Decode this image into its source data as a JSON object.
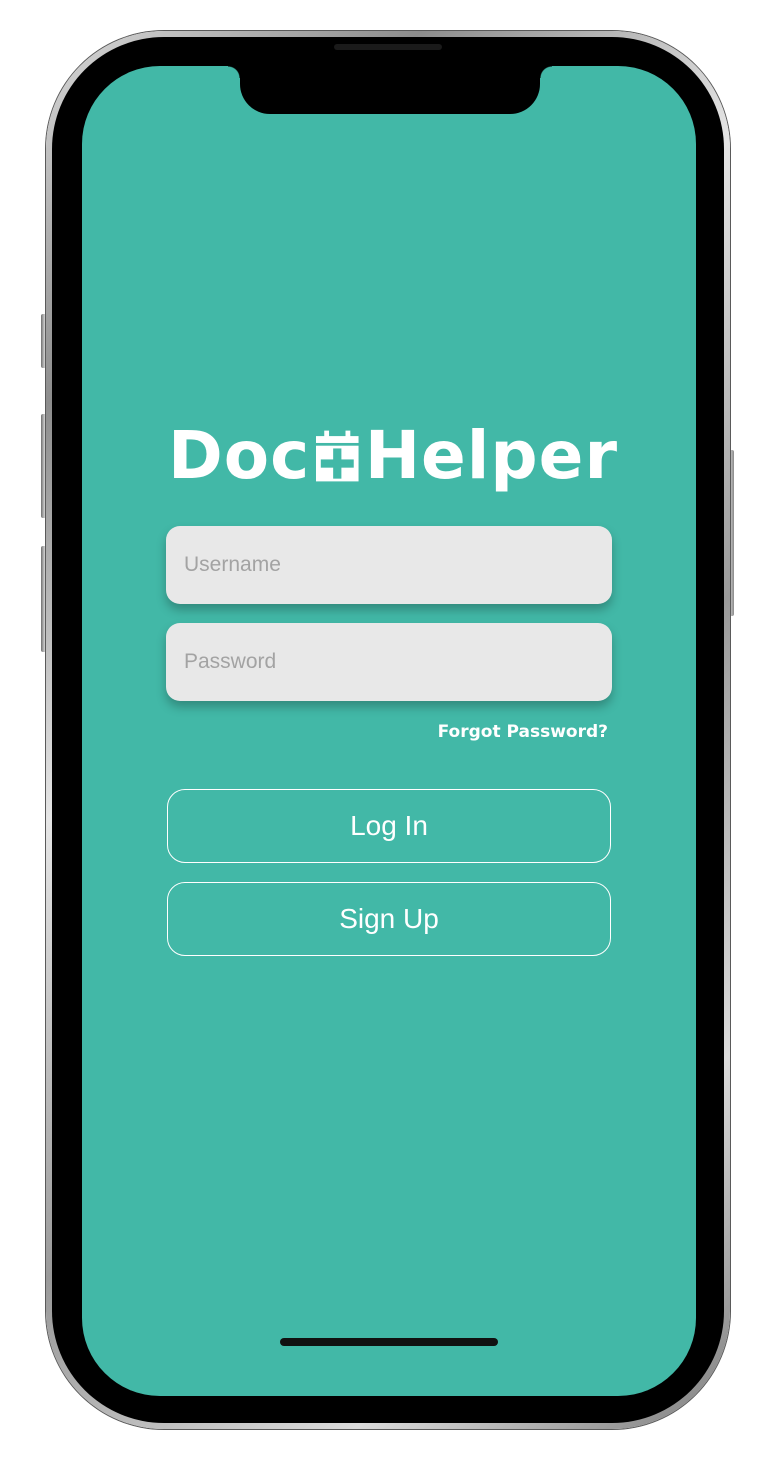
{
  "app": {
    "brand": {
      "name_part1": "Doc",
      "name_part2": "Helper",
      "icon": "calendar-plus-icon"
    },
    "login_form": {
      "username_placeholder": "Username",
      "password_placeholder": "Password",
      "forgot_password_label": "Forgot Password?",
      "login_label": "Log In",
      "signup_label": "Sign Up"
    }
  },
  "colors": {
    "background": "#42b8a7",
    "field": "#e8e8e8",
    "text_light": "#ffffff"
  }
}
